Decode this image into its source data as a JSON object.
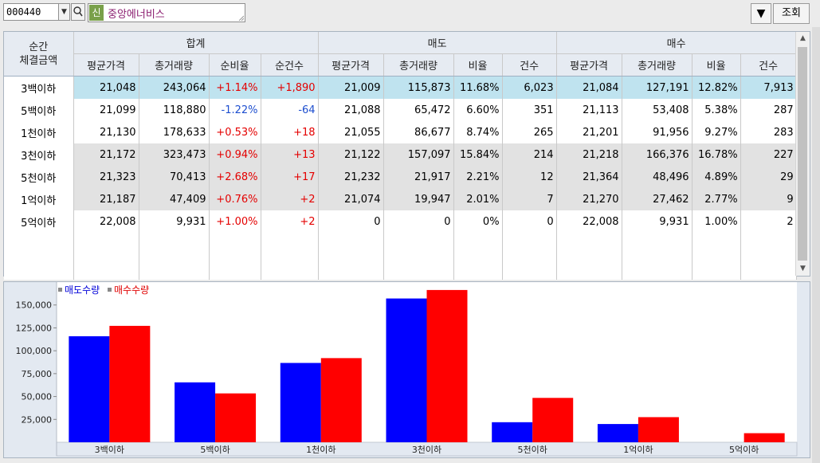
{
  "toolbar": {
    "stock_code": "000440",
    "badge": "신",
    "stock_name": "중앙에너비스",
    "dropdown_label": "▼",
    "query_label": "조회"
  },
  "table": {
    "corner_label_1": "순간",
    "corner_label_2": "체결금액",
    "groups": [
      "합계",
      "매도",
      "매수"
    ],
    "columns": [
      "평균가격",
      "총거래량",
      "순비율",
      "순건수",
      "평균가격",
      "총거래량",
      "비율",
      "건수",
      "평균가격",
      "총거래량",
      "비율",
      "건수"
    ],
    "rows": [
      {
        "label": "3백이하",
        "cells": [
          "21,048",
          "243,064",
          "+1.14%",
          "+1,890",
          "21,009",
          "115,873",
          "11.68%",
          "6,023",
          "21,084",
          "127,191",
          "12.82%",
          "7,913"
        ]
      },
      {
        "label": "5백이하",
        "cells": [
          "21,099",
          "118,880",
          "-1.22%",
          "-64",
          "21,088",
          "65,472",
          "6.60%",
          "351",
          "21,113",
          "53,408",
          "5.38%",
          "287"
        ]
      },
      {
        "label": "1천이하",
        "cells": [
          "21,130",
          "178,633",
          "+0.53%",
          "+18",
          "21,055",
          "86,677",
          "8.74%",
          "265",
          "21,201",
          "91,956",
          "9.27%",
          "283"
        ]
      },
      {
        "label": "3천이하",
        "cells": [
          "21,172",
          "323,473",
          "+0.94%",
          "+13",
          "21,122",
          "157,097",
          "15.84%",
          "214",
          "21,218",
          "166,376",
          "16.78%",
          "227"
        ]
      },
      {
        "label": "5천이하",
        "cells": [
          "21,323",
          "70,413",
          "+2.68%",
          "+17",
          "21,232",
          "21,917",
          "2.21%",
          "12",
          "21,364",
          "48,496",
          "4.89%",
          "29"
        ]
      },
      {
        "label": "1억이하",
        "cells": [
          "21,187",
          "47,409",
          "+0.76%",
          "+2",
          "21,074",
          "19,947",
          "2.01%",
          "7",
          "21,270",
          "27,462",
          "2.77%",
          "9"
        ]
      },
      {
        "label": "5억이하",
        "cells": [
          "22,008",
          "9,931",
          "+1.00%",
          "+2",
          "0",
          "0",
          "0%",
          "0",
          "22,008",
          "9,931",
          "1.00%",
          "2"
        ]
      }
    ]
  },
  "colors": {
    "sell": "#0000ff",
    "buy": "#ff0000",
    "positive": "#e40000",
    "negative": "#1d4ecf",
    "selected_row": "#bfe3ef"
  },
  "chart_data": {
    "type": "bar",
    "legend": [
      "매도수량",
      "매수수량"
    ],
    "categories": [
      "3백이하",
      "5백이하",
      "1천이하",
      "3천이하",
      "5천이하",
      "1억이하",
      "5억이하"
    ],
    "series": [
      {
        "name": "매도수량",
        "values": [
          115873,
          65472,
          86677,
          157097,
          21917,
          19947,
          0
        ]
      },
      {
        "name": "매수수량",
        "values": [
          127191,
          53408,
          91956,
          166376,
          48496,
          27462,
          9931
        ]
      }
    ],
    "yticks": [
      25000,
      50000,
      75000,
      100000,
      125000,
      150000
    ],
    "ytick_labels": [
      "25,000",
      "50,000",
      "75,000",
      "100,000",
      "125,000",
      "150,000"
    ],
    "ylim": [
      0,
      175000
    ],
    "grid": false,
    "legend_position": "top-left"
  }
}
